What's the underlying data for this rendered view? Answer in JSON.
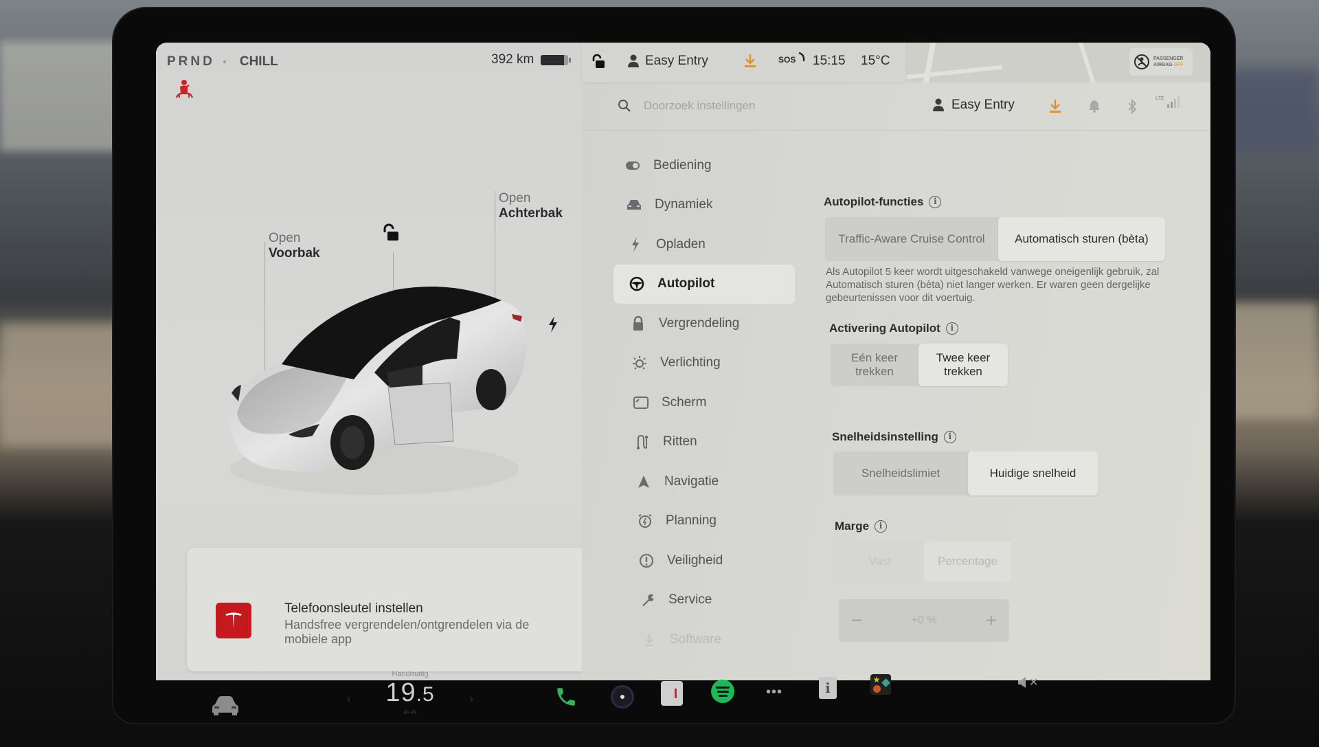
{
  "status_bar": {
    "gear": "PRND",
    "drive_mode": "CHILL",
    "range": "392 km",
    "battery_fraction": 0.85,
    "profile": "Easy Entry",
    "sos": "SOS",
    "time": "15:15",
    "temperature": "15°C",
    "airbag_line1": "PASSENGER",
    "airbag_line2": "AIRBAG",
    "airbag_state": "OFF"
  },
  "vehicle_panel": {
    "frunk": {
      "action": "Open",
      "label": "Voorbak"
    },
    "trunk": {
      "action": "Open",
      "label": "Achterbak"
    },
    "phone_key": {
      "title": "Telefoonsleutel instellen",
      "subtitle": "Handsfree vergrendelen/ontgrendelen via de mobiele app"
    }
  },
  "settings_header": {
    "search_placeholder": "Doorzoek instellingen",
    "profile": "Easy Entry",
    "signal_label": "LTE"
  },
  "menu": {
    "items": [
      {
        "label": "Bediening",
        "icon": "toggle-icon"
      },
      {
        "label": "Dynamiek",
        "icon": "car-front-icon"
      },
      {
        "label": "Opladen",
        "icon": "bolt-icon"
      },
      {
        "label": "Autopilot",
        "icon": "steering-wheel-icon",
        "active": true
      },
      {
        "label": "Vergrendeling",
        "icon": "lock-icon"
      },
      {
        "label": "Verlichting",
        "icon": "light-icon"
      },
      {
        "label": "Scherm",
        "icon": "display-icon"
      },
      {
        "label": "Ritten",
        "icon": "trips-icon"
      },
      {
        "label": "Navigatie",
        "icon": "navigation-icon"
      },
      {
        "label": "Planning",
        "icon": "alarm-clock-icon"
      },
      {
        "label": "Veiligheid",
        "icon": "alert-circle-icon"
      },
      {
        "label": "Service",
        "icon": "wrench-icon"
      },
      {
        "label": "Software",
        "icon": "download-icon"
      }
    ]
  },
  "autopilot": {
    "features": {
      "label": "Autopilot-functies",
      "options": [
        "Traffic-Aware Cruise Control",
        "Automatisch sturen (bèta)"
      ],
      "selected": 1,
      "description": "Als Autopilot 5 keer wordt uitgeschakeld vanwege oneigenlijk gebruik, zal Automatisch sturen (bèta) niet langer werken. Er waren geen dergelijke gebeurtenissen voor dit voertuig."
    },
    "activation": {
      "label": "Activering Autopilot",
      "options": [
        "Eén keer trekken",
        "Twee keer trekken"
      ],
      "selected": 1
    },
    "speed_setting": {
      "label": "Snelheidsinstelling",
      "options": [
        "Snelheidslimiet",
        "Huidige snelheid"
      ],
      "selected": 1
    },
    "margin": {
      "label": "Marge",
      "options": [
        "Vast",
        "Percentage"
      ],
      "selected": 1,
      "disabled": true,
      "value": "+0 %",
      "minus": "−",
      "plus": "+"
    }
  },
  "bottom_bar": {
    "climate_mode": "Handmatig",
    "temp_whole": "19",
    "temp_decimal": ".5",
    "apps": [
      "phone",
      "camera",
      "energy",
      "spotify",
      "more",
      "manual",
      "toybox"
    ]
  },
  "colors": {
    "accent_red": "#c5191f",
    "download_orange": "#e0902f",
    "spotify_green": "#1db954",
    "phone_green": "#34b35a"
  }
}
